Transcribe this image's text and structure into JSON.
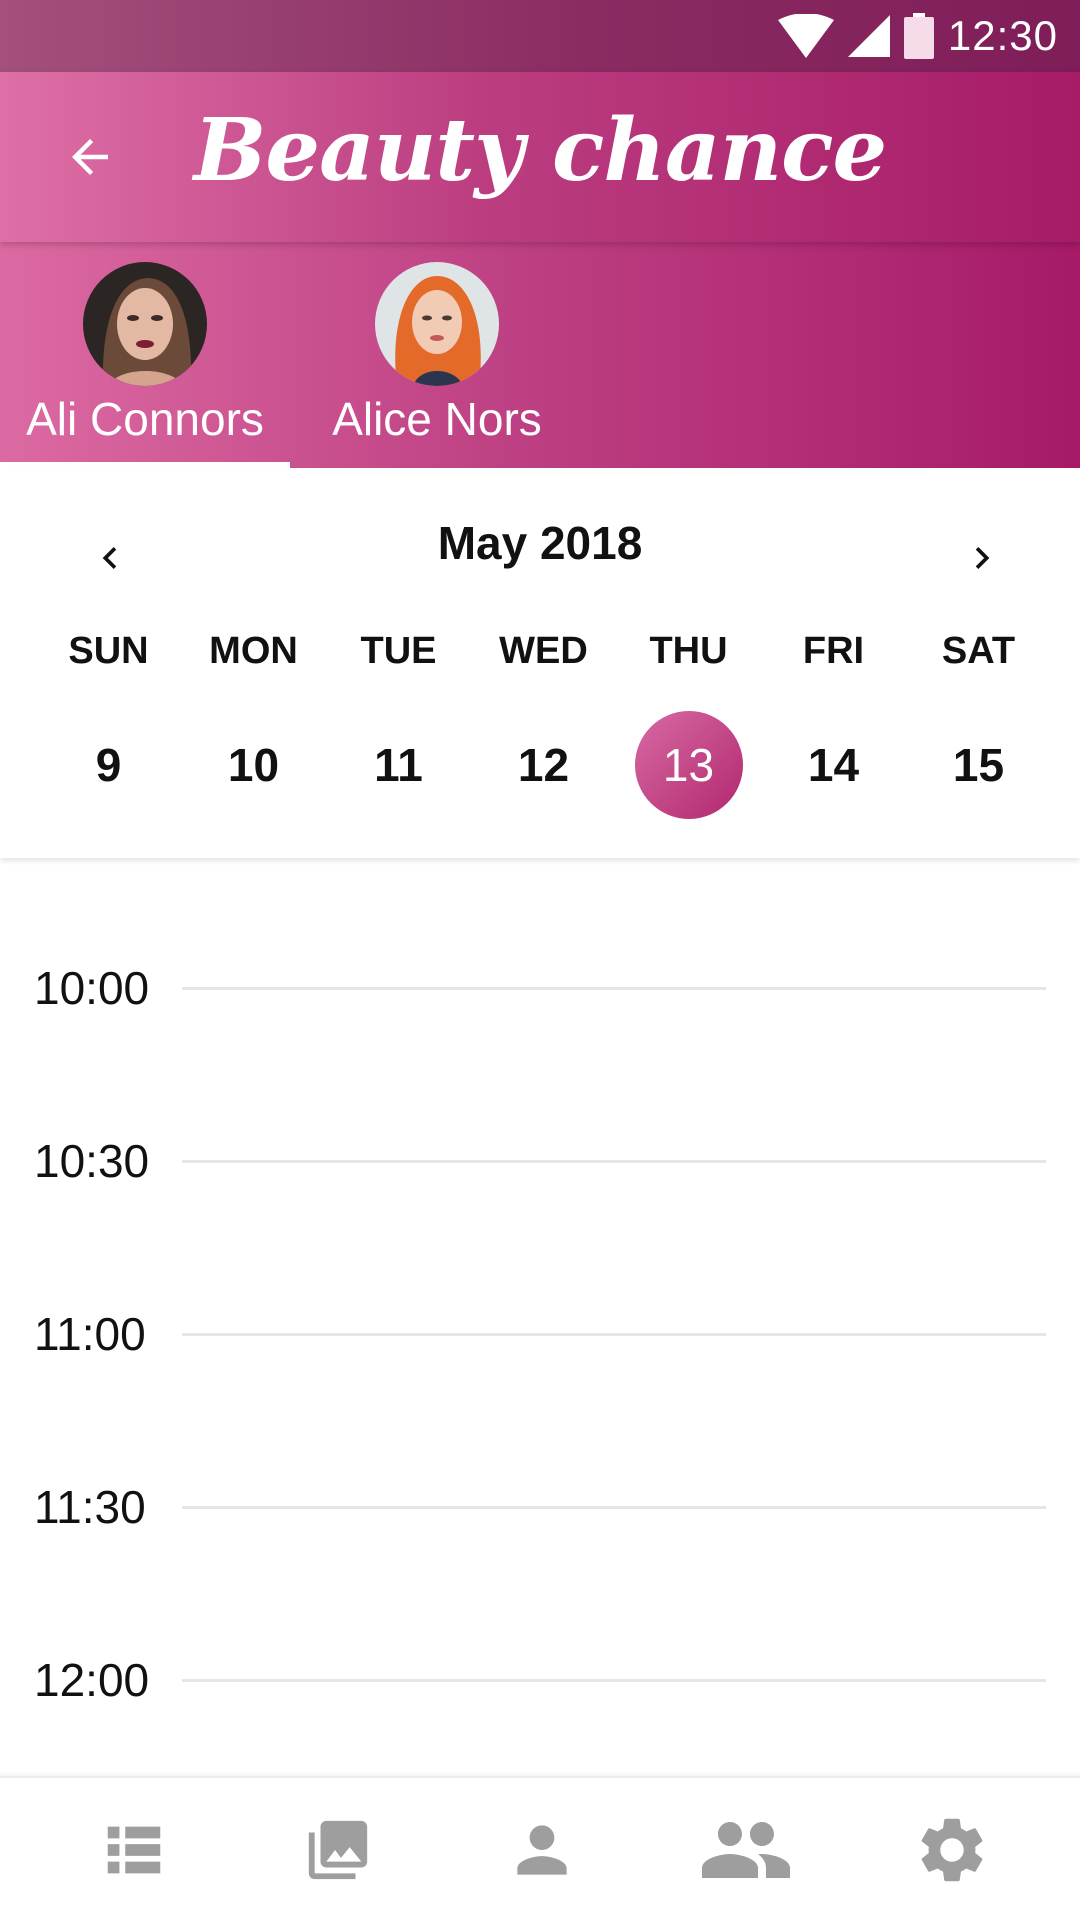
{
  "status_bar": {
    "time": "12:30",
    "icons": [
      "wifi-icon",
      "signal-icon",
      "battery-icon"
    ]
  },
  "app_bar": {
    "title": "Beauty chance",
    "back_icon": "arrow-back-icon"
  },
  "tabs": [
    {
      "label": "Ali Connors",
      "selected": true
    },
    {
      "label": "Alice Nors",
      "selected": false
    }
  ],
  "calendar": {
    "month": "May 2018",
    "weekdays": [
      "SUN",
      "MON",
      "TUE",
      "WED",
      "THU",
      "FRI",
      "SAT"
    ],
    "days": [
      "9",
      "10",
      "11",
      "12",
      "13",
      "14",
      "15"
    ],
    "selected_day": "13"
  },
  "timeline": {
    "slots": [
      "10:00",
      "10:30",
      "11:00",
      "11:30",
      "12:00"
    ]
  },
  "bottom_nav": {
    "items": [
      "list-icon",
      "photo-library-icon",
      "person-icon",
      "group-icon",
      "settings-icon"
    ]
  },
  "colors": {
    "primary": "#b62f76",
    "status_bar": "#8a2b62",
    "icon_gray": "#9e9e9e"
  }
}
